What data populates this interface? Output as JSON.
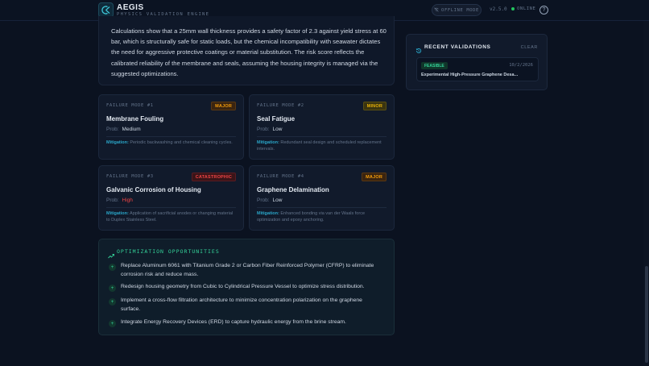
{
  "header": {
    "title": "AEGIS",
    "subtitle": "PHYSICS VALIDATION ENGINE",
    "offline_label": "OFFLINE MODE",
    "version": "v2.5.0",
    "status": "ONLINE",
    "help_icon": "question-circle-icon"
  },
  "summary": {
    "text": "Calculations show that a 25mm wall thickness provides a safety factor of 2.3 against yield stress at 60 bar, which is structurally safe for static loads, but the chemical incompatibility with seawater dictates the need for aggressive protective coatings or material substitution. The risk score reflects the calibrated reliability of the membrane and seals, assuming the housing integrity is managed via the suggested optimizations."
  },
  "failure_modes": [
    {
      "label": "FAILURE MODE #1",
      "severity": "MAJOR",
      "title": "Membrane Fouling",
      "prob_label": "Prob:",
      "prob": "Medium",
      "mitigation_label": "Mitigation:",
      "mitigation": "Periodic backwashing and chemical cleaning cycles."
    },
    {
      "label": "FAILURE MODE #2",
      "severity": "MINOR",
      "title": "Seal Fatigue",
      "prob_label": "Prob:",
      "prob": "Low",
      "mitigation_label": "Mitigation:",
      "mitigation": "Redundant seal design and scheduled replacement intervals."
    },
    {
      "label": "FAILURE MODE #3",
      "severity": "CATASTROPHIC",
      "title": "Galvanic Corrosion of Housing",
      "prob_label": "Prob:",
      "prob": "High",
      "mitigation_label": "Mitigation:",
      "mitigation": "Application of sacrificial anodes or changing material to Duplex Stainless Steel."
    },
    {
      "label": "FAILURE MODE #4",
      "severity": "MAJOR",
      "title": "Graphene Delamination",
      "prob_label": "Prob:",
      "prob": "Low",
      "mitigation_label": "Mitigation:",
      "mitigation": "Enhanced bonding via van der Waals force optimization and epoxy anchoring."
    }
  ],
  "optimization": {
    "title": "OPTIMIZATION OPPORTUNITIES",
    "bullet": "+",
    "items": [
      "Replace Aluminum 6061 with Titanium Grade 2 or Carbon Fiber Reinforced Polymer (CFRP) to eliminate corrosion risk and reduce mass.",
      "Redesign housing geometry from Cubic to Cylindrical Pressure Vessel to optimize stress distribution.",
      "Implement a cross-flow filtration architecture to minimize concentration polarization on the graphene surface.",
      "Integrate Energy Recovery Devices (ERD) to capture hydraulic energy from the brine stream."
    ]
  },
  "recent": {
    "title": "RECENT VALIDATIONS",
    "clear_label": "CLEAR",
    "items": [
      {
        "status": "FEASIBLE",
        "date": "10/2/2026",
        "name": "Experimental High-Pressure Graphene Desa..."
      }
    ]
  },
  "colors": {
    "background": "#0b1220",
    "accent_green": "#34d399",
    "accent_cyan": "#2aa6c9",
    "major": "#f59e0b",
    "minor": "#eab308",
    "catastrophic": "#ef4444"
  }
}
